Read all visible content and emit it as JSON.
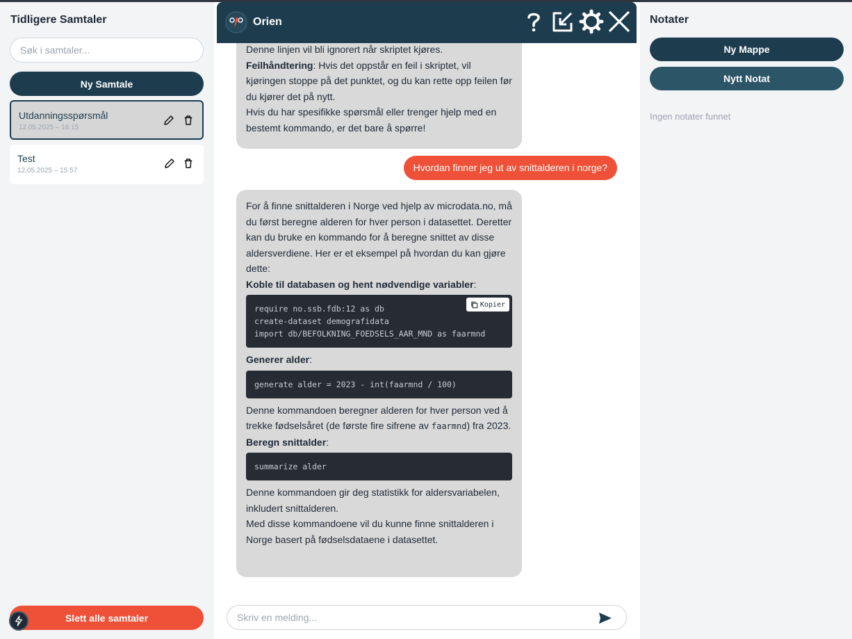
{
  "sidebar": {
    "title": "Tidligere Samtaler",
    "search_placeholder": "Søk i samtaler...",
    "new_button": "Ny Samtale",
    "conversations": [
      {
        "title": "Utdanningsspørsmål",
        "date": "12.05.2025 – 16:15",
        "active": true
      },
      {
        "title": "Test",
        "date": "12.05.2025 – 15:57",
        "active": false
      }
    ],
    "delete_all_button": "Slett alle samtaler"
  },
  "chat": {
    "title": "Orien",
    "header_icons": [
      "help-icon",
      "popout-icon",
      "settings-icon",
      "close-icon"
    ],
    "messages": [
      {
        "role": "assistant",
        "cut_line": "Denne linjen vil bli ignorert når skriptet kjøres.",
        "error_heading": "Feilhåndtering",
        "error_text": ": Hvis det oppstår en feil i skriptet, vil kjøringen stoppe på det punktet, og du kan rette opp feilen før du kjører det på nytt.",
        "closing": "Hvis du har spesifikke spørsmål eller trenger hjelp med en bestemt kommando, er det bare å spørre!"
      },
      {
        "role": "user",
        "text": "Hvordan finner jeg ut av snittalderen i norge?"
      },
      {
        "role": "assistant",
        "intro": "For å finne snittalderen i Norge ved hjelp av microdata.no, må du først beregne alderen for hver person i datasettet. Deretter kan du bruke en kommando for å beregne snittet av disse aldersverdiene. Her er et eksempel på hvordan du kan gjøre dette:",
        "step1_heading": "Koble til databasen og hent nødvendige variabler",
        "code1_line1": "require no.ssb.fdb:12 as db",
        "code1_line2": "create-dataset demografidata",
        "code1_line3": "import db/BEFOLKNING_FOEDSELS_AAR_MND as faarmnd",
        "copy_label": "Kopier",
        "step2_heading": "Generer alder",
        "code2": "generate alder = 2023 - int(faarmnd / 100)",
        "step2_text_a": "Denne kommandoen beregner alderen for hver person ved å trekke fødselsåret (de første fire sifrene av ",
        "step2_code": "faarmnd",
        "step2_text_b": ") fra 2023.",
        "step3_heading": "Beregn snittalder",
        "code3": "summarize alder",
        "step3_text": "Denne kommandoen gir deg statistikk for aldersvariabelen, inkludert snittalderen.",
        "closing": "Med disse kommandoene vil du kunne finne snittalderen i Norge basert på fødselsdataene i datasettet."
      }
    ],
    "input_placeholder": "Skriv en melding..."
  },
  "notes": {
    "title": "Notater",
    "new_folder_button": "Ny Mappe",
    "new_note_button": "Nytt Notat",
    "empty_text": "Ingen notater funnet"
  },
  "colors": {
    "primary": "#1d3d4f",
    "accent": "#ee5138",
    "bubble": "#d9d9d9",
    "code_bg": "#272b33"
  }
}
